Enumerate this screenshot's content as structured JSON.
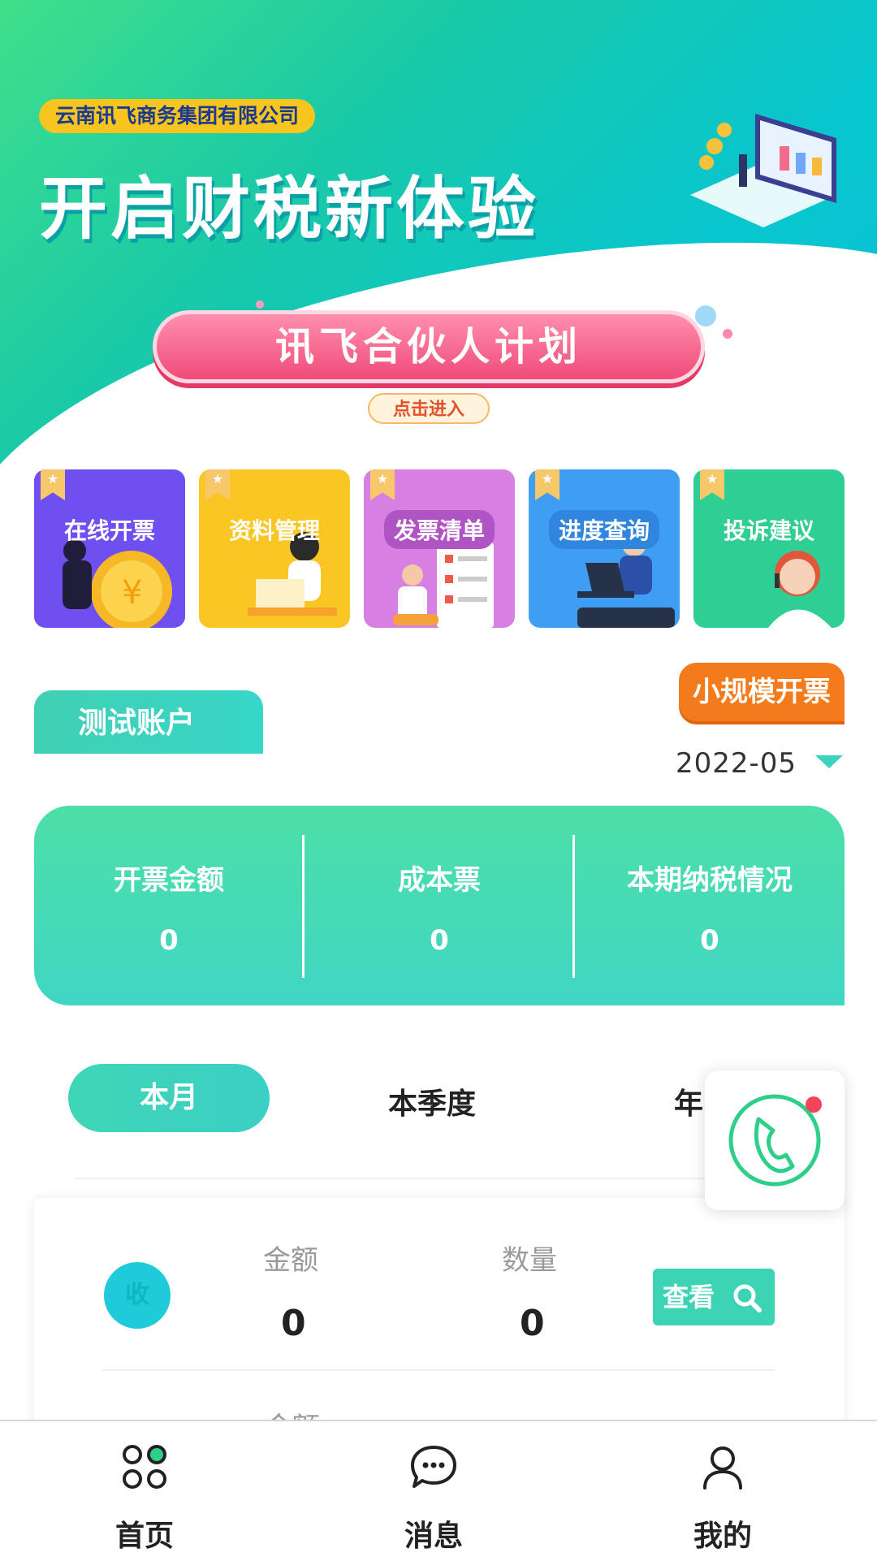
{
  "banner": {
    "company": "云南讯飞商务集团有限公司",
    "slogan": "开启财税新体验",
    "partner_title": "讯飞合伙人计划",
    "partner_button": "点击进入"
  },
  "services": [
    {
      "label": "在线开票",
      "color": "#6f4ff0",
      "icon": "coin-icon"
    },
    {
      "label": "资料管理",
      "color": "#f9c623",
      "icon": "reading-person-icon"
    },
    {
      "label": "发票清单",
      "color": "#d77fe2",
      "icon": "checklist-icon"
    },
    {
      "label": "进度查询",
      "color": "#3f9ef2",
      "icon": "laptop-person-icon"
    },
    {
      "label": "投诉建议",
      "color": "#2fce94",
      "icon": "support-agent-icon"
    }
  ],
  "account": {
    "name": "测试账户",
    "mode": "小规模开票",
    "date": "2022-05"
  },
  "stats": [
    {
      "title": "开票金额",
      "value": "0"
    },
    {
      "title": "成本票",
      "value": "0"
    },
    {
      "title": "本期纳税情况",
      "value": "0"
    }
  ],
  "periods": {
    "active": "本月",
    "quarter": "本季度",
    "year": "年"
  },
  "list": {
    "badge": "收",
    "amount_label": "金额",
    "amount_value": "0",
    "count_label": "数量",
    "count_value": "0",
    "view_label": "查看",
    "next_amount_label": "金额"
  },
  "nav": {
    "home": "首页",
    "messages": "消息",
    "mine": "我的"
  },
  "colors": {
    "accent": "#3dd4b6",
    "orange": "#f37b1c",
    "pink": "#f04c78"
  }
}
